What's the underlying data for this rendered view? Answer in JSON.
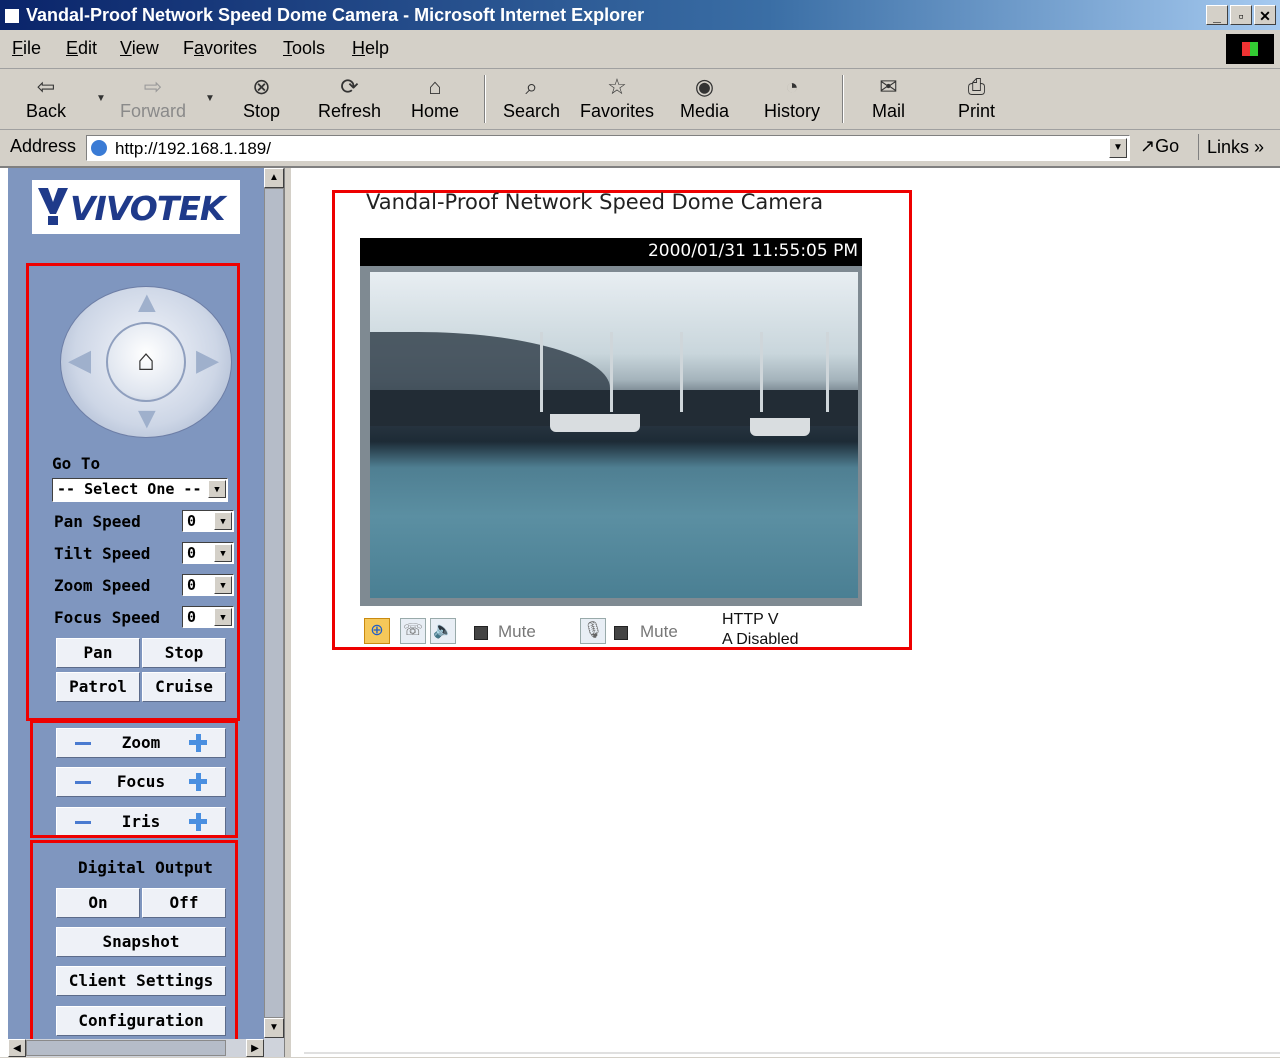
{
  "window": {
    "title": "Vandal-Proof Network Speed Dome Camera - Microsoft Internet Explorer",
    "controls": [
      "_",
      "▫",
      "✕"
    ]
  },
  "menu": [
    {
      "key": "F",
      "rest": "ile"
    },
    {
      "key": "E",
      "rest": "dit"
    },
    {
      "key": "V",
      "rest": "iew"
    },
    {
      "pre": "F",
      "key": "a",
      "rest": "vorites"
    },
    {
      "key": "T",
      "rest": "ools"
    },
    {
      "key": "H",
      "rest": "elp"
    }
  ],
  "toolbar": {
    "back": "Back",
    "forward": "Forward",
    "stop": "Stop",
    "refresh": "Refresh",
    "home": "Home",
    "search": "Search",
    "favorites": "Favorites",
    "media": "Media",
    "history": "History",
    "mail": "Mail",
    "print": "Print"
  },
  "address": {
    "label": "Address",
    "url": "http://192.168.1.189/",
    "go": "Go",
    "links": "Links"
  },
  "sidebar": {
    "logo": "VIVOTEK",
    "goto_label": "Go To",
    "goto_value": "-- Select One --",
    "pan_speed_label": "Pan Speed",
    "pan_speed_value": "0",
    "tilt_speed_label": "Tilt Speed",
    "tilt_speed_value": "0",
    "zoom_speed_label": "Zoom Speed",
    "zoom_speed_value": "0",
    "focus_speed_label": "Focus Speed",
    "focus_speed_value": "0",
    "pan": "Pan",
    "stop": "Stop",
    "patrol": "Patrol",
    "cruise": "Cruise",
    "zoom": "Zoom",
    "focus": "Focus",
    "iris": "Iris",
    "digital_output_label": "Digital Output",
    "on": "On",
    "off": "Off",
    "snapshot": "Snapshot",
    "client_settings": "Client Settings",
    "configuration": "Configuration"
  },
  "main": {
    "title": "Vandal-Proof Network Speed Dome Camera",
    "timestamp": "2000/01/31 11:55:05 PM",
    "mute1": "Mute",
    "mute2": "Mute",
    "protocol_line1": "HTTP  V",
    "protocol_line2": "A Disabled"
  },
  "colors": {
    "sidebar_bg": "#7f96bf",
    "highlight_box": "#e00000",
    "title_bar": "#0a246a"
  }
}
